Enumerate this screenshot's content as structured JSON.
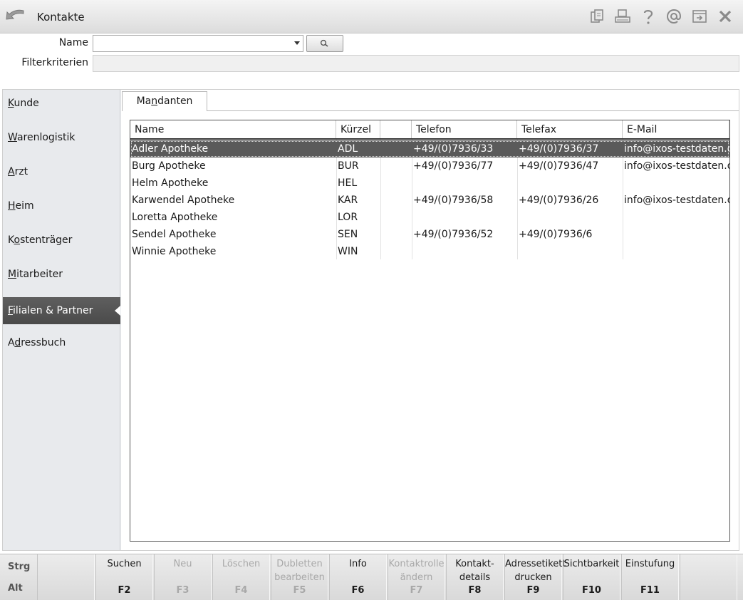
{
  "window": {
    "title": "Kontakte"
  },
  "toolbar_icons": [
    "copy-icon",
    "print-icon",
    "help-icon",
    "email-icon",
    "export-icon",
    "close-icon"
  ],
  "filter": {
    "name_label": "Name",
    "name_value": "",
    "criteria_label": "Filterkriterien",
    "criteria_value": ""
  },
  "sidebar": {
    "items": [
      {
        "label": "Kunde",
        "accel": "K"
      },
      {
        "label": "Warenlogistik",
        "accel": "W"
      },
      {
        "label": "Arzt",
        "accel": "A"
      },
      {
        "label": "Heim",
        "accel": "H"
      },
      {
        "label": "Kostenträger",
        "accel": "o"
      },
      {
        "label": "Mitarbeiter",
        "accel": "M"
      },
      {
        "label": "Filialen & Partner",
        "accel": "F",
        "active": true
      },
      {
        "label": "Adressbuch",
        "accel": "d"
      }
    ]
  },
  "tab": {
    "label": "Mandanten"
  },
  "table": {
    "columns": [
      "Name",
      "Kürzel",
      "",
      "Telefon",
      "Telefax",
      "E-Mail"
    ],
    "rows": [
      [
        "Adler Apotheke",
        "ADL",
        "",
        "+49/(0)7936/33",
        "+49/(0)7936/37",
        "info@ixos-testdaten.de"
      ],
      [
        "Burg Apotheke",
        "BUR",
        "",
        "+49/(0)7936/77",
        "+49/(0)7936/47",
        "info@ixos-testdaten.de"
      ],
      [
        "Helm Apotheke",
        "HEL",
        "",
        "",
        "",
        ""
      ],
      [
        "Karwendel Apotheke",
        "KAR",
        "",
        "+49/(0)7936/58",
        "+49/(0)7936/26",
        "info@ixos-testdaten.de"
      ],
      [
        "Loretta Apotheke",
        "LOR",
        "",
        "",
        "",
        ""
      ],
      [
        "Sendel Apotheke",
        "SEN",
        "",
        "+49/(0)7936/52",
        "+49/(0)7936/6",
        ""
      ],
      [
        "Winnie Apotheke",
        "WIN",
        "",
        "",
        "",
        ""
      ]
    ],
    "selected_row": 0
  },
  "footer": {
    "modifiers": [
      "Strg",
      "Alt"
    ],
    "keys": [
      {
        "label": "",
        "key": "",
        "enabled": true
      },
      {
        "label": "Suchen",
        "key": "F2",
        "enabled": true
      },
      {
        "label": "Neu",
        "key": "F3",
        "enabled": false
      },
      {
        "label": "Löschen",
        "key": "F4",
        "enabled": false
      },
      {
        "label": "Dubletten bearbeiten",
        "key": "F5",
        "enabled": false
      },
      {
        "label": "Info",
        "key": "F6",
        "enabled": true
      },
      {
        "label": "Kontaktrolle ändern",
        "key": "F7",
        "enabled": false
      },
      {
        "label": "Kontakt-details",
        "key": "F8",
        "enabled": true
      },
      {
        "label": "Adressetikett drucken",
        "key": "F9",
        "enabled": true
      },
      {
        "label": "Sichtbarkeit",
        "key": "F10",
        "enabled": true
      },
      {
        "label": "Einstufung",
        "key": "F11",
        "enabled": true
      },
      {
        "label": "",
        "key": "",
        "enabled": true
      }
    ]
  }
}
